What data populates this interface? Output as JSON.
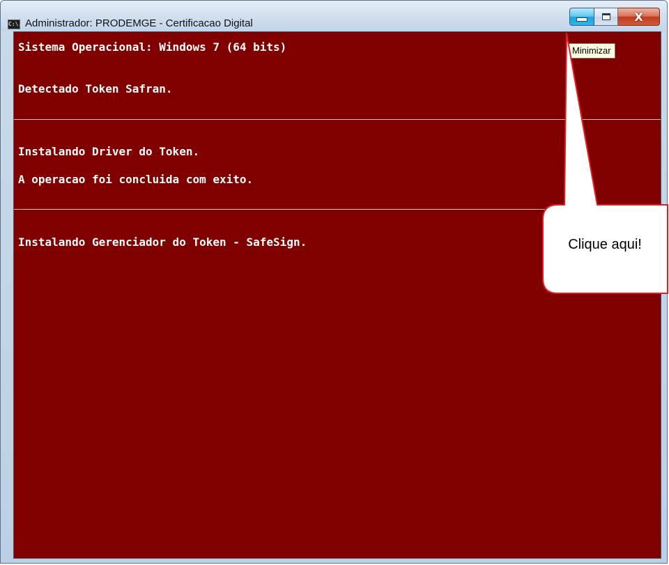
{
  "window": {
    "title": "Administrador:  PRODEMGE - Certificacao Digital",
    "title_icon": "C:\\."
  },
  "caption_buttons": {
    "minimize_icon": "minimize-icon",
    "maximize_icon": "maximize-icon",
    "close_icon": "close-icon",
    "close_glyph": "X"
  },
  "tooltip": {
    "text": "Minimizar"
  },
  "console": {
    "lines": [
      "Sistema Operacional: Windows 7 (64 bits)",
      "Detectado Token Safran.",
      "Instalando Driver do Token.",
      "A operacao foi concluida com exito.",
      "Instalando Gerenciador do Token - SafeSign."
    ],
    "background_color": "#800000",
    "text_color": "#ffffff"
  },
  "callout": {
    "text": "Clique aqui!",
    "stroke_color": "#e02020"
  }
}
